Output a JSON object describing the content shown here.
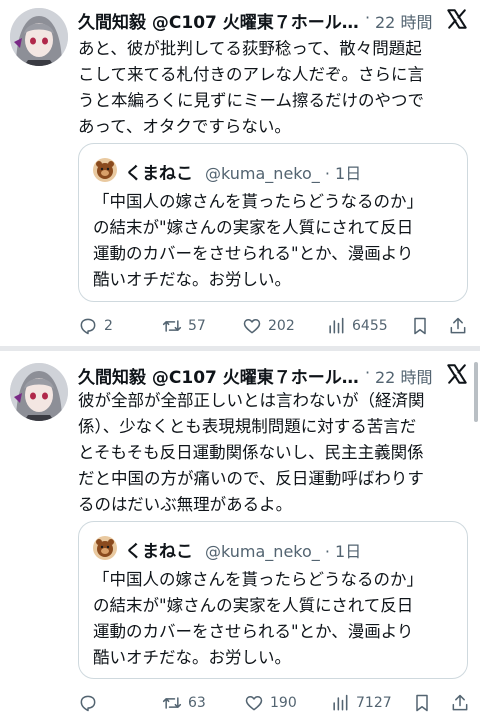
{
  "posts": [
    {
      "author_name": "久間知毅 @C107 火曜東７ホール…",
      "timestamp": "22 時間",
      "text_lines": [
        "あと、彼が批判してる荻野稔って、散々問題起",
        "こして来てる札付きのアレな人だぞ。さらに言",
        "うと本編ろくに見ずにミーム擦るだけのやつで",
        "あって、オタクですらない。"
      ],
      "quote": {
        "author_name": "くまねこ",
        "handle_time": "@kuma_neko_ · 1日",
        "text_lines": [
          "「中国人の嫁さんを貰ったらどうなるのか」",
          "の結末が\"嫁さんの実家を人質にされて反日",
          "運動のカバーをさせられる\"とか、漫画より",
          "酷いオチだな。お労しい。"
        ]
      },
      "actions": {
        "replies": "2",
        "reposts": "57",
        "likes": "202",
        "views": "6455"
      }
    },
    {
      "author_name": "久間知毅 @C107 火曜東７ホール…",
      "timestamp": "22 時間",
      "text_lines": [
        "彼が全部が全部正しいとは言わないが（経済関",
        "係）、少なくとも表現規制問題に対する苦言だ",
        "とそもそも反日運動関係ないし、民主主義関係",
        "だと中国の方が痛いので、反日運動呼ばわりす",
        "るのはだいぶ無理があるよ。"
      ],
      "quote": {
        "author_name": "くまねこ",
        "handle_time": "@kuma_neko_ · 1日",
        "text_lines": [
          "「中国人の嫁さんを貰ったらどうなるのか」",
          "の結末が\"嫁さんの実家を人質にされて反日",
          "運動のカバーをさせられる\"とか、漫画より",
          "酷いオチだな。お労しい。"
        ]
      },
      "actions": {
        "replies": "",
        "reposts": "63",
        "likes": "190",
        "views": "7127"
      }
    }
  ],
  "colors": {
    "text": "#0f1419",
    "secondary": "#536471",
    "border": "#cfd9de",
    "divider": "#e6e8eb"
  },
  "icons": [
    "x-logo-icon",
    "reply-icon",
    "repost-icon",
    "like-icon",
    "views-icon",
    "bookmark-icon",
    "share-icon"
  ]
}
